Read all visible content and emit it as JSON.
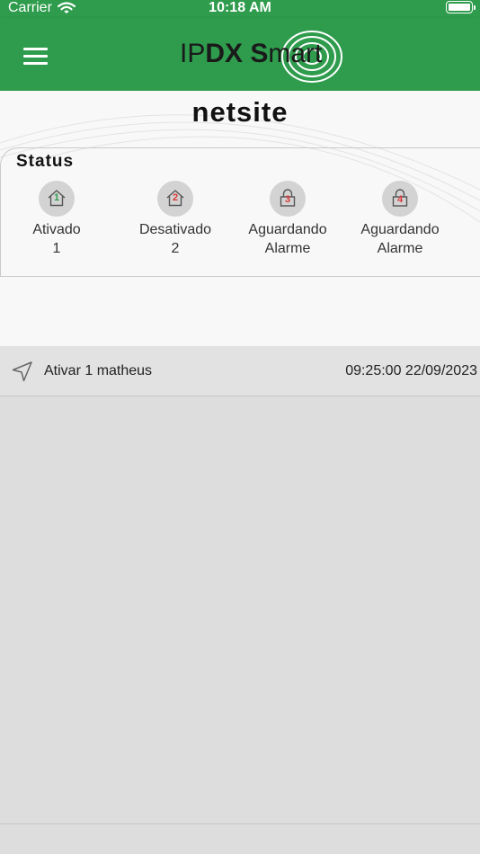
{
  "status_bar": {
    "carrier": "Carrier",
    "time": "10:18 AM"
  },
  "app_bar": {
    "logo_prefix": "IP",
    "logo_bold": "DX S",
    "logo_suffix": "mart"
  },
  "site": {
    "title": "netsite"
  },
  "status": {
    "label": "Status",
    "items": [
      {
        "number": "1",
        "line1": "Ativado",
        "line2": "1",
        "icon": "house-icon",
        "number_color": "#2e9c4c"
      },
      {
        "number": "2",
        "line1": "Desativado",
        "line2": "2",
        "icon": "house-icon",
        "number_color": "#d93838"
      },
      {
        "number": "3",
        "line1": "Aguardando",
        "line2": "Alarme",
        "icon": "padlock-icon",
        "number_color": "#d93838"
      },
      {
        "number": "4",
        "line1": "Aguardando",
        "line2": "Alarme",
        "icon": "padlock-icon",
        "number_color": "#d93838"
      }
    ]
  },
  "events": [
    {
      "text": "Ativar 1  matheus",
      "timestamp": "09:25:00 22/09/2023",
      "icon": "navigation-arrow-icon"
    }
  ],
  "colors": {
    "brand": "#2e9c4c",
    "list_bg": "#dddddd"
  }
}
